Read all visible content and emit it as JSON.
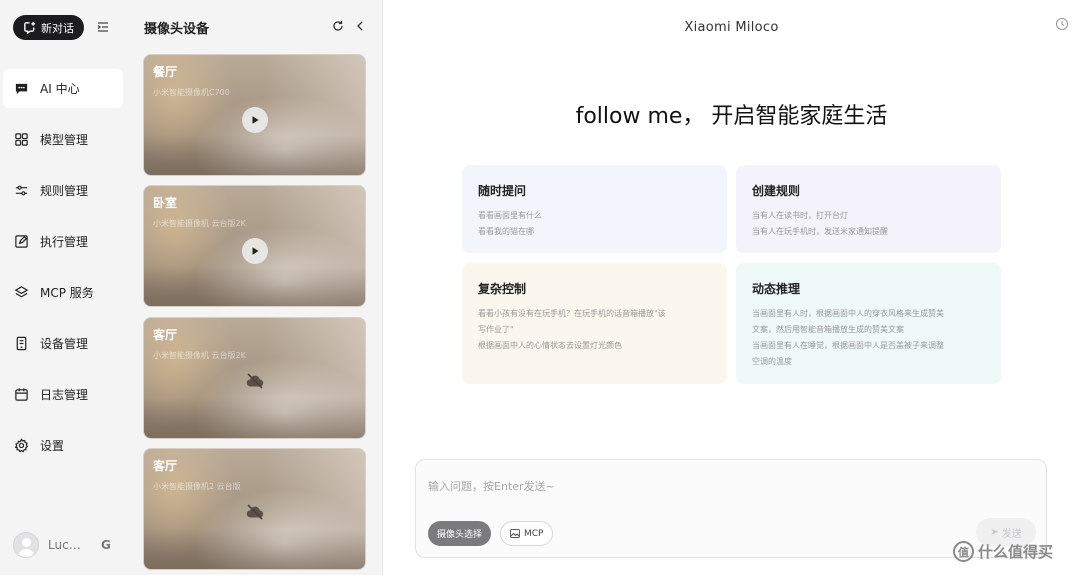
{
  "sidebar": {
    "new_chat_label": "新对话",
    "items": [
      {
        "label": "AI 中心",
        "icon": "chat-icon",
        "active": true
      },
      {
        "label": "模型管理",
        "icon": "grid-icon"
      },
      {
        "label": "规则管理",
        "icon": "sliders-icon"
      },
      {
        "label": "执行管理",
        "icon": "edit-icon"
      },
      {
        "label": "MCP 服务",
        "icon": "layers-icon"
      },
      {
        "label": "设备管理",
        "icon": "device-icon"
      },
      {
        "label": "日志管理",
        "icon": "calendar-icon"
      },
      {
        "label": "设置",
        "icon": "gear-icon"
      }
    ],
    "user": {
      "name": "Luci...",
      "status": "G"
    }
  },
  "camera_panel": {
    "title": "摄像头设备",
    "cameras": [
      {
        "name": "餐厅",
        "model": "小米智能摄像机C700",
        "state": "play"
      },
      {
        "name": "卧室",
        "model": "小米智能摄像机 云台版2K",
        "state": "play"
      },
      {
        "name": "客厅",
        "model": "小米智能摄像机 云台版2K",
        "state": "offline"
      },
      {
        "name": "客厅",
        "model": "小米智能摄像机2 云台版",
        "state": "offline"
      }
    ]
  },
  "main": {
    "app_title": "Xiaomi Miloco",
    "hero": "follow me， 开启智能家庭生活",
    "cards": [
      {
        "title": "随时提问",
        "lines": [
          "看看画面里有什么",
          "看看我的猫在哪"
        ]
      },
      {
        "title": "创建规则",
        "lines": [
          "当有人在读书时，打开台灯",
          "当有人在玩手机时，发送米家通知提醒"
        ]
      },
      {
        "title": "复杂控制",
        "lines": [
          "看看小孩有没有在玩手机？在玩手机的话音箱播放\"该",
          "写作业了\"",
          "根据画面中人的心情状态去设置灯光颜色"
        ]
      },
      {
        "title": "动态推理",
        "lines": [
          "当画面里有人时，根据画面中人的穿衣风格来生成赞美",
          "文案，然后用智能音箱播放生成的赞美文案",
          "当画面里有人在睡觉，根据画面中人是否盖被子来调整",
          "空调的温度"
        ]
      }
    ],
    "input": {
      "placeholder": "输入问题，按Enter发送~",
      "camera_chip": "摄像头选择",
      "mcp_chip": "MCP",
      "send_label": "发送"
    }
  },
  "watermark": {
    "icon_text": "值",
    "text": "什么值得买"
  },
  "colors": {
    "primary": "#1c1c1e",
    "panel_bg": "#f4f4f5"
  }
}
